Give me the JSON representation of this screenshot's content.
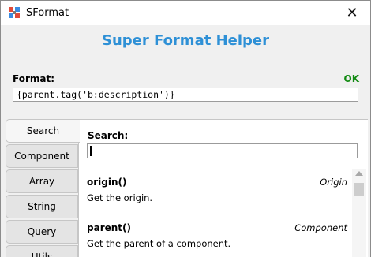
{
  "window": {
    "title": "SFormat",
    "close_glyph": "✕"
  },
  "header": {
    "title": "Super Format Helper"
  },
  "format": {
    "label": "Format:",
    "value": "{parent.tag('b:description')}",
    "status": "OK",
    "status_color": "#118a11"
  },
  "tabs": [
    {
      "label": "Search",
      "active": true
    },
    {
      "label": "Component",
      "active": false
    },
    {
      "label": "Array",
      "active": false
    },
    {
      "label": "String",
      "active": false
    },
    {
      "label": "Query",
      "active": false
    },
    {
      "label": "Utils",
      "active": false
    }
  ],
  "search": {
    "label": "Search:",
    "value": ""
  },
  "results": [
    {
      "name": "origin()",
      "category": "Origin",
      "description": "Get the origin."
    },
    {
      "name": "parent()",
      "category": "Component",
      "description": "Get the parent of a component."
    }
  ],
  "colors": {
    "accent": "#2e90d6"
  }
}
